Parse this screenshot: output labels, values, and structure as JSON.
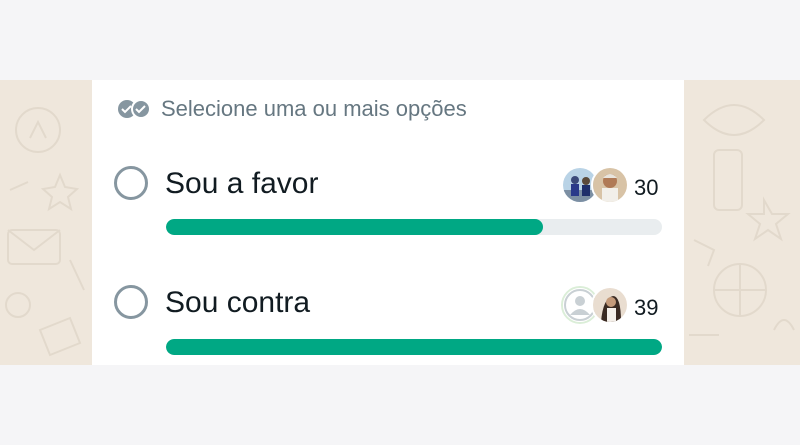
{
  "poll": {
    "hint": "Selecione uma ou mais opções",
    "options": [
      {
        "label": "Sou a favor",
        "count": "30",
        "progress": 0.76
      },
      {
        "label": "Sou contra",
        "count": "39",
        "progress": 1.0
      }
    ]
  },
  "icons": {
    "hint": "double-check-icon",
    "radio": "radio-unchecked-icon",
    "avatar_placeholder": "default-user-icon"
  },
  "colors": {
    "accent": "#00a884",
    "track": "#e9edef",
    "muted_text": "#667781",
    "radio_border": "#8696a0",
    "wallpaper": "#efe7dc"
  }
}
